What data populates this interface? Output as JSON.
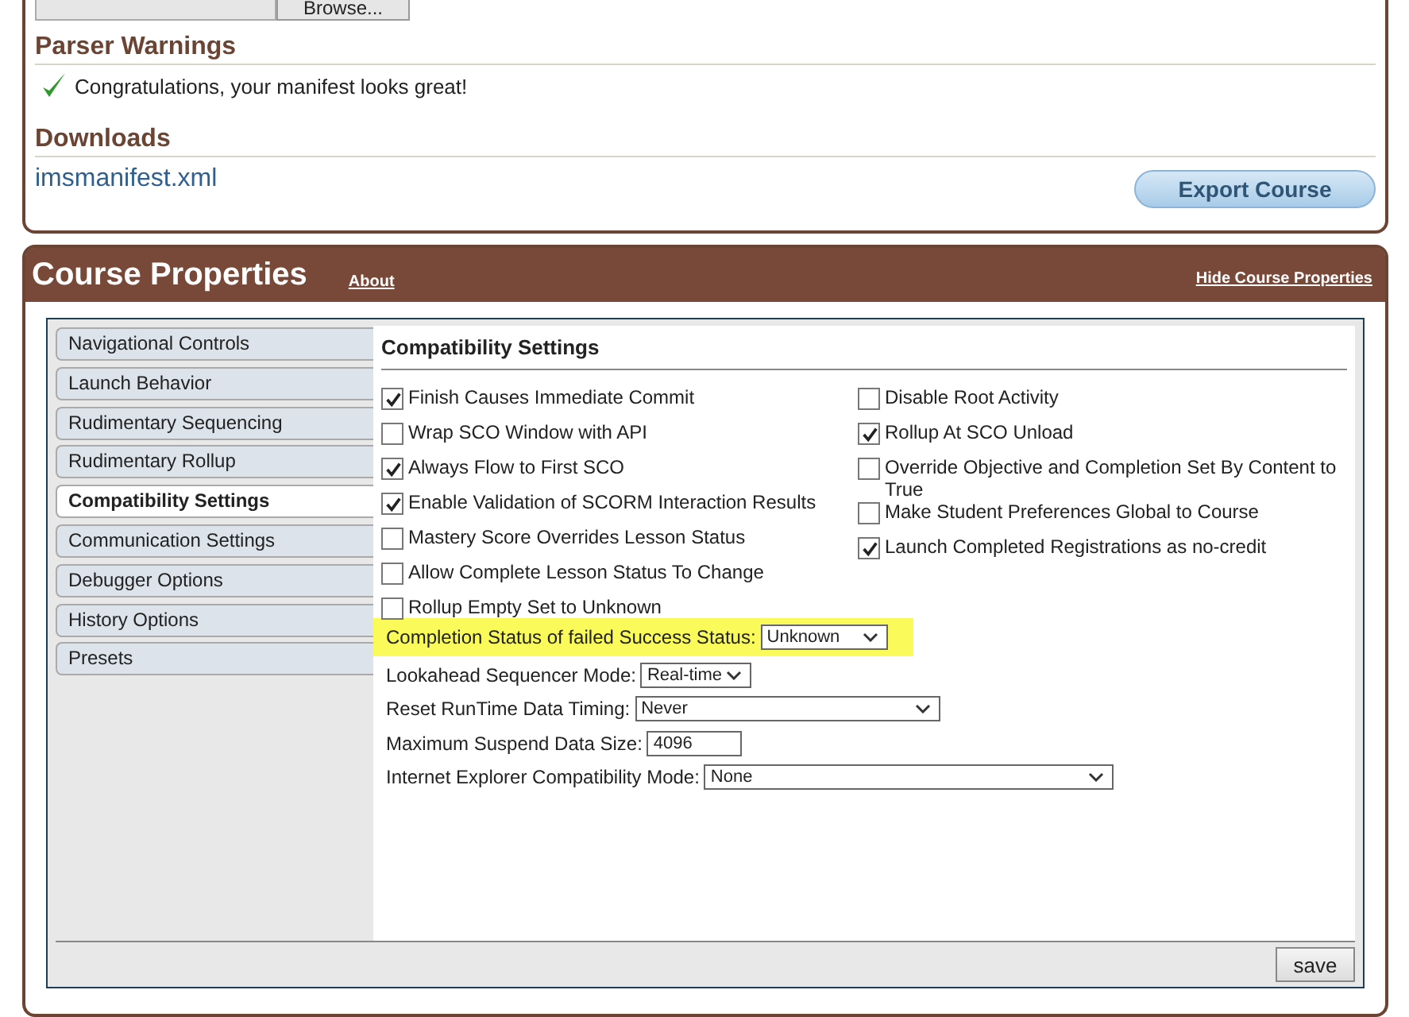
{
  "upload": {
    "browse_button": "Browse..."
  },
  "parser_warnings": {
    "title": "Parser Warnings",
    "messages": [
      {
        "kind": "success",
        "text": "Congratulations, your manifest looks great!"
      }
    ]
  },
  "downloads": {
    "title": "Downloads",
    "files": [
      "imsmanifest.xml"
    ],
    "export_button": "Export Course"
  },
  "course_properties": {
    "title": "Course Properties",
    "about_link": "About",
    "hide_link": "Hide Course Properties",
    "sidebar": {
      "items": [
        {
          "label": "Navigational Controls",
          "selected": false
        },
        {
          "label": "Launch Behavior",
          "selected": false
        },
        {
          "label": "Rudimentary Sequencing",
          "selected": false
        },
        {
          "label": "Rudimentary Rollup",
          "selected": false
        },
        {
          "label": "Compatibility Settings",
          "selected": true
        },
        {
          "label": "Communication Settings",
          "selected": false
        },
        {
          "label": "Debugger Options",
          "selected": false
        },
        {
          "label": "History Options",
          "selected": false
        },
        {
          "label": "Presets",
          "selected": false
        }
      ]
    },
    "section_title": "Compatibility Settings",
    "checkboxes_left": [
      {
        "label": "Finish Causes Immediate Commit",
        "checked": true
      },
      {
        "label": "Wrap SCO Window with API",
        "checked": false
      },
      {
        "label": "Always Flow to First SCO",
        "checked": true
      },
      {
        "label": "Enable Validation of SCORM Interaction Results",
        "checked": true
      },
      {
        "label": "Mastery Score Overrides Lesson Status",
        "checked": false
      },
      {
        "label": "Allow Complete Lesson Status To Change",
        "checked": false
      },
      {
        "label": "Rollup Empty Set to Unknown",
        "checked": false
      }
    ],
    "checkboxes_right": [
      {
        "label": "Disable Root Activity",
        "checked": false
      },
      {
        "label": "Rollup At SCO Unload",
        "checked": true
      },
      {
        "label": "Override Objective and Completion Set By Content to True",
        "checked": false
      },
      {
        "label": "Make Student Preferences Global to Course",
        "checked": false
      },
      {
        "label": "Launch Completed Registrations as no-credit",
        "checked": true
      }
    ],
    "fields": [
      {
        "kind": "select",
        "label": "Completion Status of failed Success Status:",
        "value": "Unknown",
        "highlighted": true
      },
      {
        "kind": "select",
        "label": "Lookahead Sequencer Mode:",
        "value": "Real-time",
        "highlighted": false
      },
      {
        "kind": "select",
        "label": "Reset RunTime Data Timing:",
        "value": "Never",
        "highlighted": false
      },
      {
        "kind": "input",
        "label": "Maximum Suspend Data Size:",
        "value": "4096",
        "highlighted": false
      },
      {
        "kind": "select",
        "label": "Internet Explorer Compatibility Mode:",
        "value": "None",
        "highlighted": false
      }
    ],
    "save_button": "save"
  }
}
